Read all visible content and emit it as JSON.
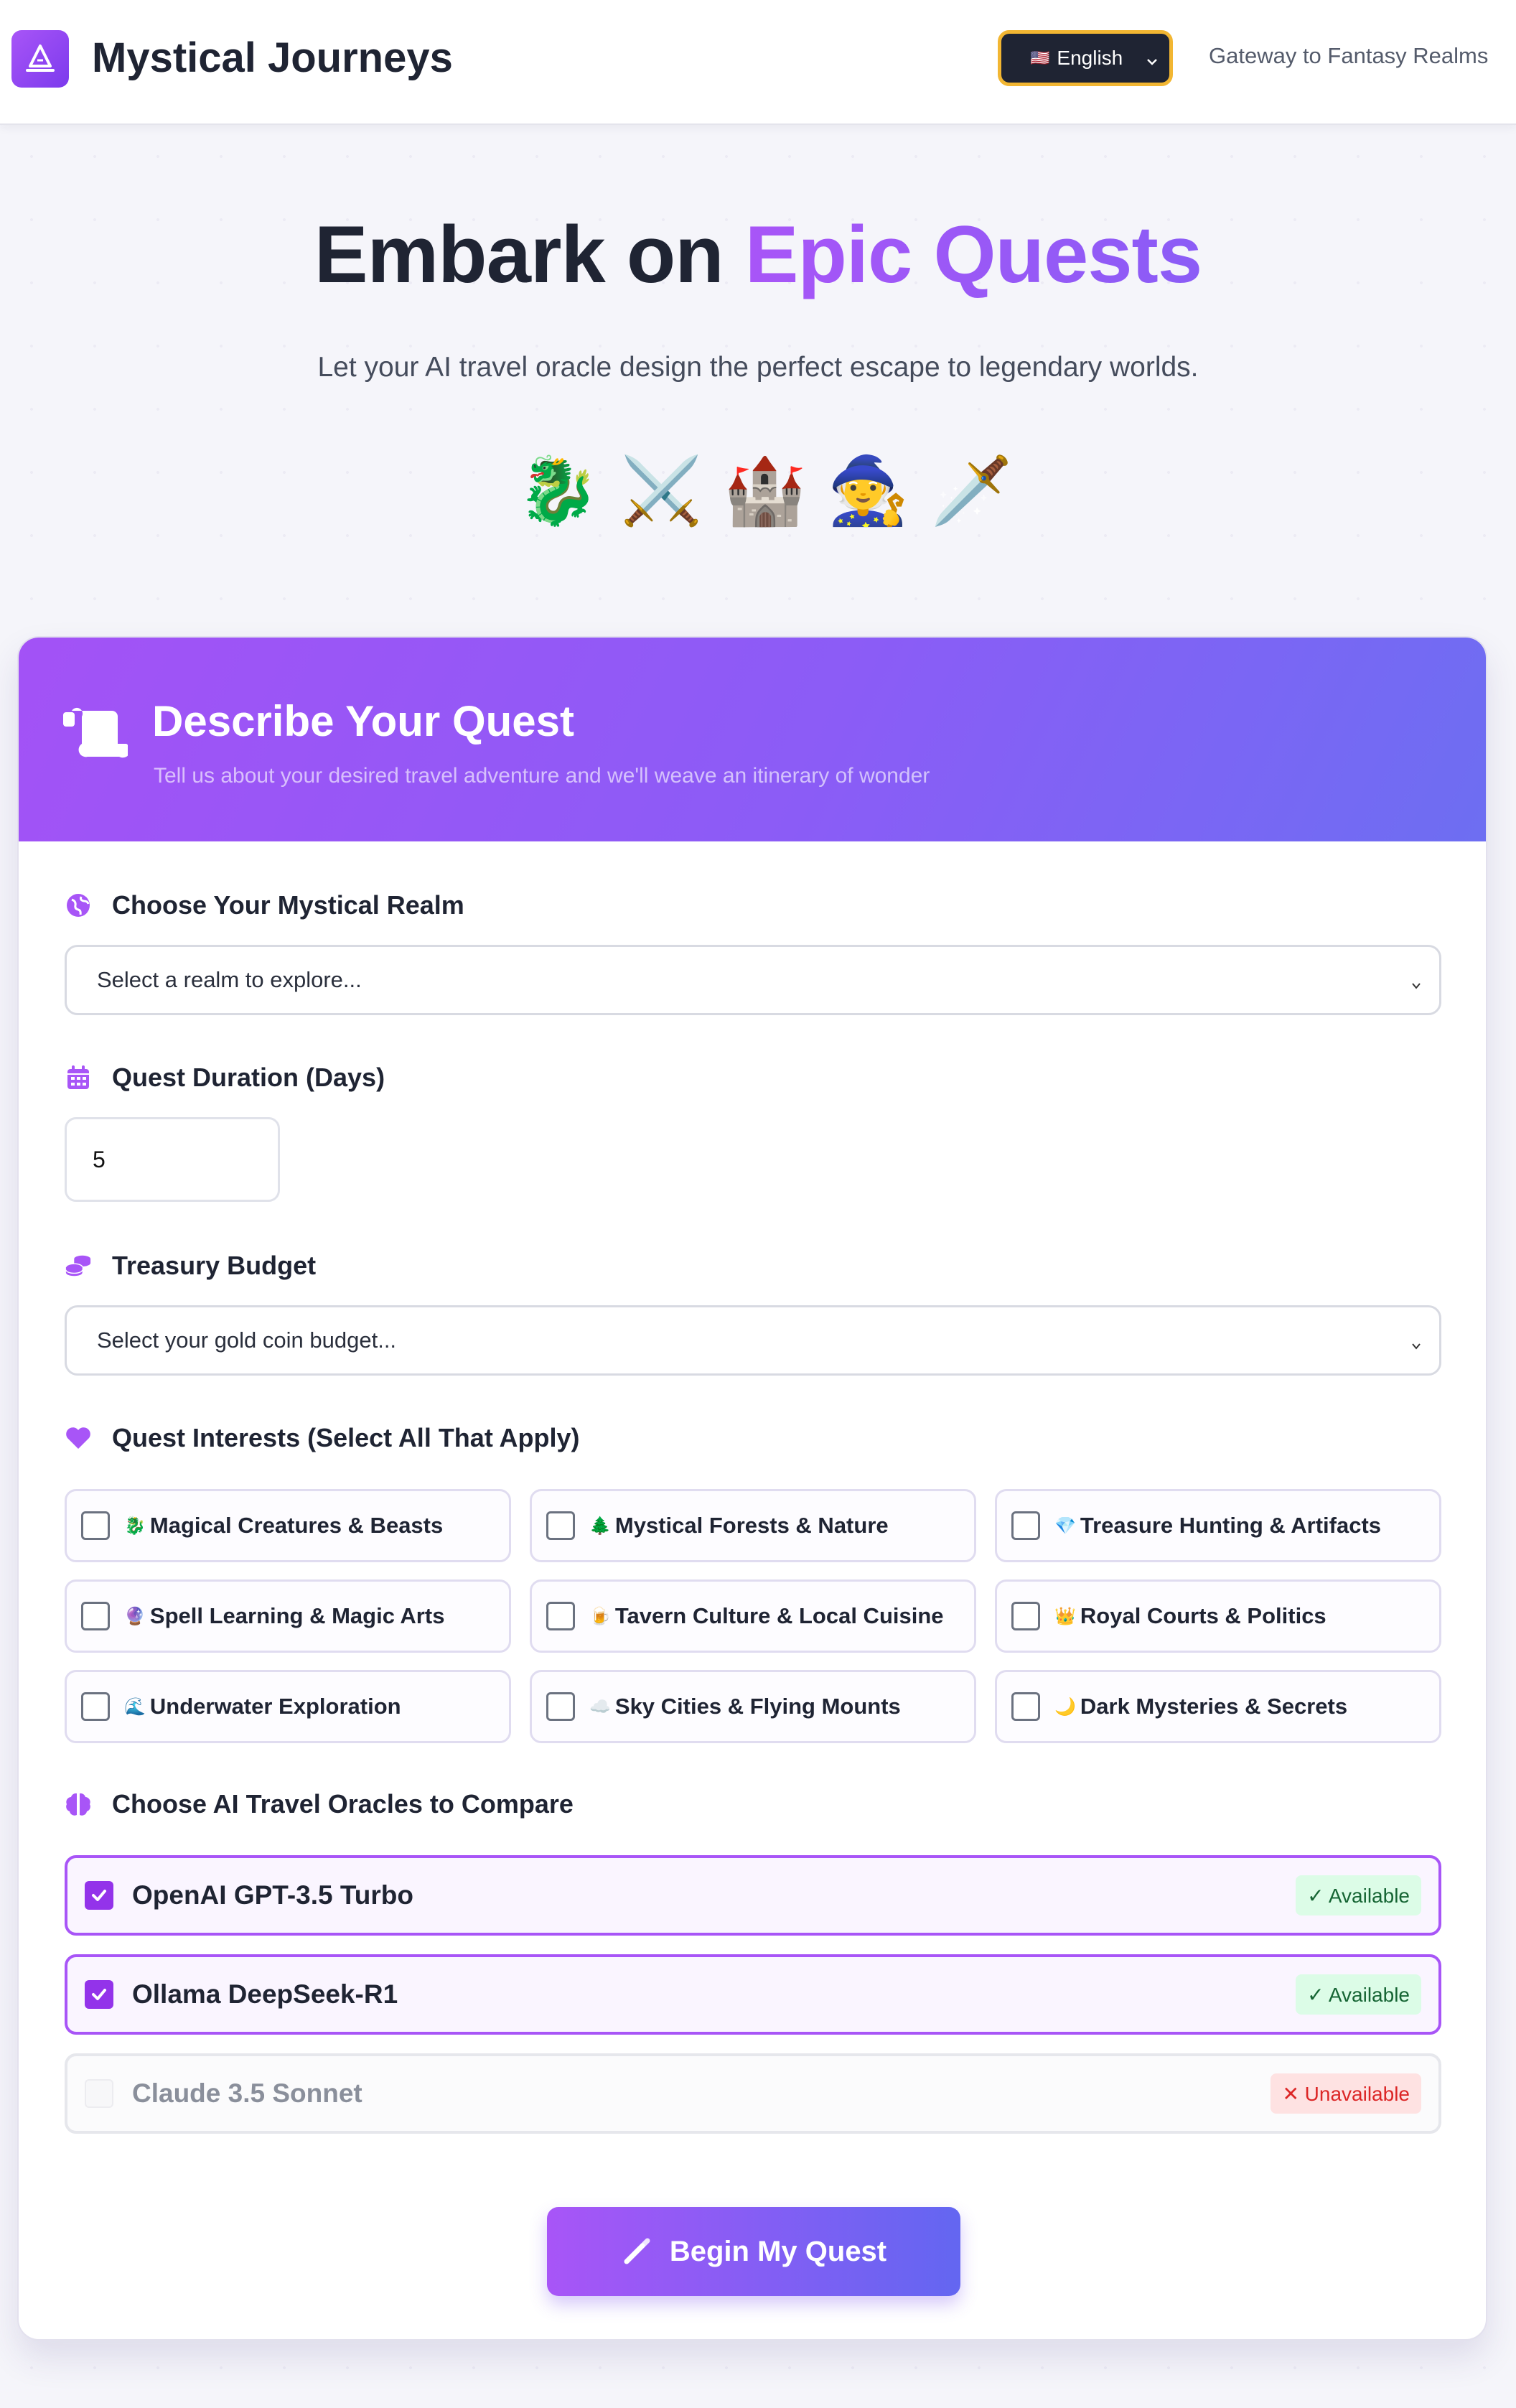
{
  "header": {
    "app_title": "Mystical Journeys",
    "language": {
      "flag": "🇺🇸",
      "selected": "English"
    },
    "tagline": "Gateway to Fantasy Realms"
  },
  "hero": {
    "title_main": "Embark on ",
    "title_accent": "Epic Quests",
    "subtitle": "Let your AI travel oracle design the perfect escape to legendary worlds.",
    "emojis": [
      "🐉",
      "⚔️",
      "🏰",
      "🧙",
      "🗡️"
    ]
  },
  "form": {
    "title": "Describe Your Quest",
    "subtitle": "Tell us about your desired travel adventure and we'll weave an itinerary of wonder",
    "realm": {
      "label": "Choose Your Mystical Realm",
      "value": "Select a realm to explore..."
    },
    "duration": {
      "label": "Quest Duration (Days)",
      "value": "5"
    },
    "budget": {
      "label": "Treasury Budget",
      "value": "Select your gold coin budget..."
    },
    "interests": {
      "label": "Quest Interests (Select All That Apply)",
      "items": [
        {
          "emoji": "🐉",
          "label": "Magical Creatures & Beasts"
        },
        {
          "emoji": "🌲",
          "label": "Mystical Forests & Nature"
        },
        {
          "emoji": "💎",
          "label": "Treasure Hunting & Artifacts"
        },
        {
          "emoji": "🔮",
          "label": "Spell Learning & Magic Arts"
        },
        {
          "emoji": "🍺",
          "label": "Tavern Culture & Local Cuisine"
        },
        {
          "emoji": "👑",
          "label": "Royal Courts & Politics"
        },
        {
          "emoji": "🌊",
          "label": "Underwater Exploration"
        },
        {
          "emoji": "☁️",
          "label": "Sky Cities & Flying Mounts"
        },
        {
          "emoji": "🌙",
          "label": "Dark Mysteries & Secrets"
        }
      ]
    },
    "oracles": {
      "label": "Choose AI Travel Oracles to Compare",
      "items": [
        {
          "name": "OpenAI GPT-3.5 Turbo",
          "status": "✓ Available"
        },
        {
          "name": "Ollama DeepSeek-R1",
          "status": "✓ Available"
        },
        {
          "name": "Claude 3.5 Sonnet",
          "status": "✕ Unavailable"
        }
      ]
    },
    "submit_label": "Begin My Quest"
  },
  "colors": {
    "accent": "#a855f7",
    "accent_end": "#6366f1",
    "language_border": "#f2b632",
    "available": "#166534",
    "unavailable": "#dc2626"
  }
}
